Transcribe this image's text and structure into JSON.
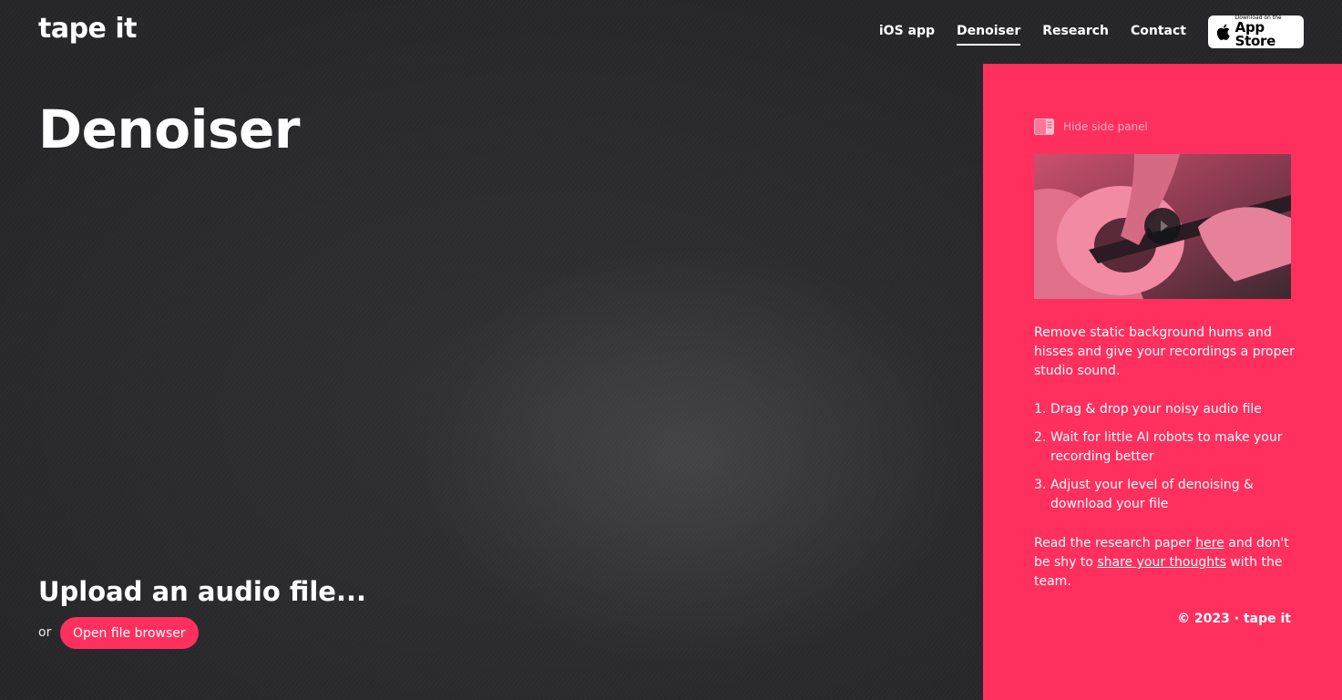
{
  "header": {
    "logo": "tape it",
    "nav": [
      {
        "label": "iOS app"
      },
      {
        "label": "Denoiser"
      },
      {
        "label": "Research"
      },
      {
        "label": "Contact"
      }
    ],
    "appstore": {
      "small": "Download on the",
      "big": "App Store"
    }
  },
  "main": {
    "title": "Denoiser",
    "upload_heading": "Upload an audio file...",
    "or": "or",
    "open_button": "Open file browser"
  },
  "side_panel": {
    "hide_label": "Hide side panel",
    "description": "Remove static background hums and hisses and give your recordings a proper studio sound.",
    "steps": [
      {
        "num": "1.",
        "text": "Drag & drop your noisy audio file"
      },
      {
        "num": "2.",
        "text": "Wait for little AI robots to make your recording better"
      },
      {
        "num": "3.",
        "text": "Adjust your level of denoising & download your file"
      }
    ],
    "research": {
      "prefix": "Read the research paper ",
      "link1": "here",
      "middle": " and don't be shy to ",
      "link2": "share your thoughts",
      "suffix": " with the team."
    },
    "footer": "© 2023 · tape it"
  },
  "colors": {
    "background": "#262628",
    "accent": "#ff2f5e",
    "text": "#ffffff"
  },
  "icons": {
    "panel": "side-panel-icon",
    "apple": "apple-icon",
    "play": "play-icon"
  }
}
